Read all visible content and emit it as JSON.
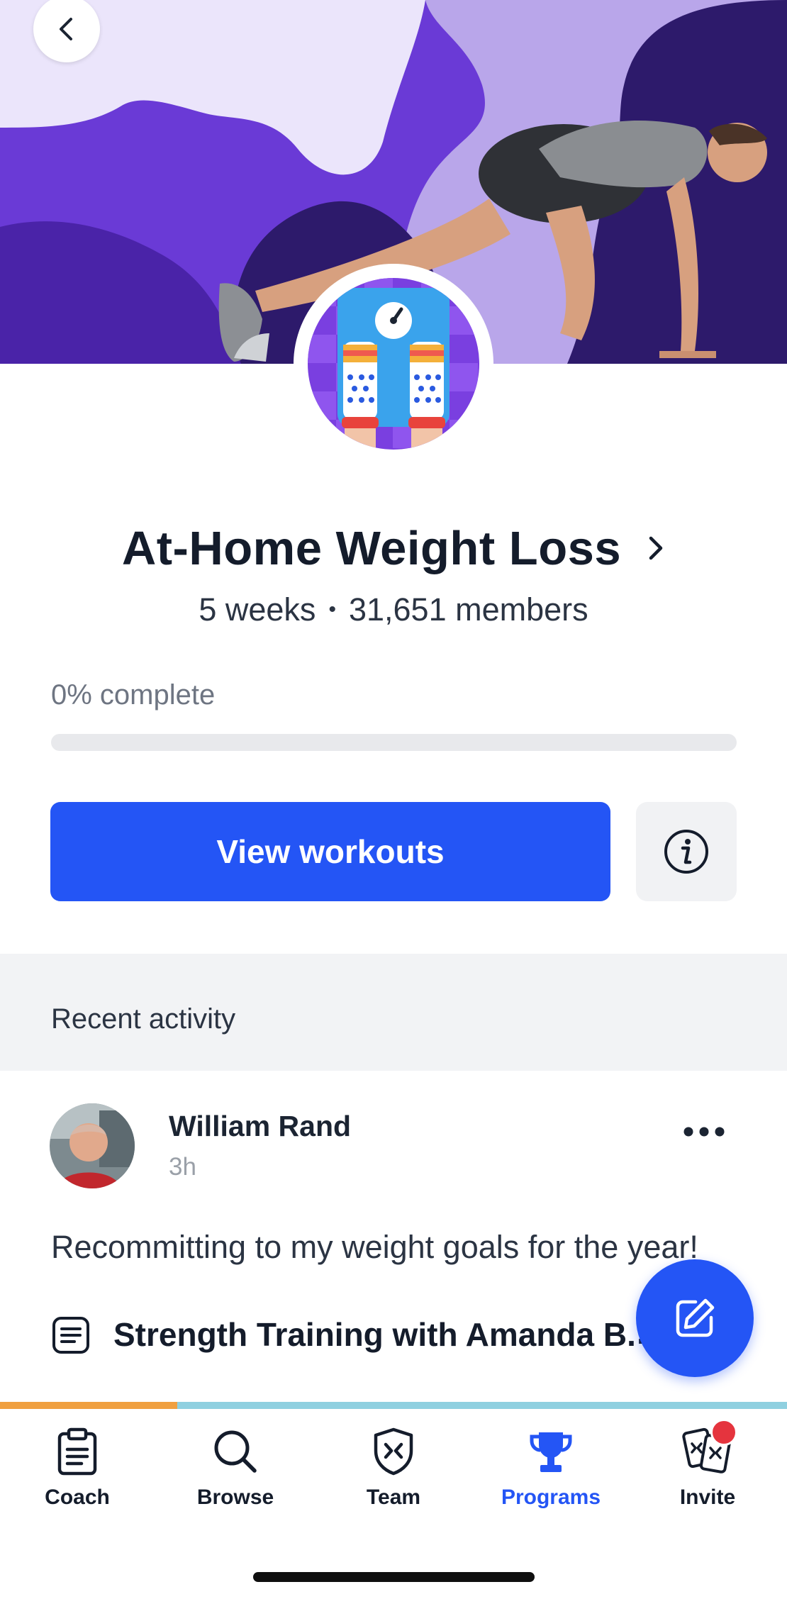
{
  "hero": {
    "colors": {
      "base": "#6a3ad6",
      "light": "#ebe5fb",
      "mid": "#b9a6ea",
      "dark": "#4a23a8",
      "deep": "#2d1a6b"
    }
  },
  "program": {
    "title": "At-Home Weight Loss",
    "duration": "5 weeks",
    "separator": "•",
    "members": "31,651 members"
  },
  "progress": {
    "label": "0% complete",
    "value": 0
  },
  "actions": {
    "view_workouts": "View workouts"
  },
  "recent_activity": {
    "title": "Recent activity",
    "post": {
      "author": "William Rand",
      "time": "3h",
      "body": "Recommitting to my weight goals for the year!",
      "workout": "Strength Training with Amanda B.",
      "workout_trail": "."
    }
  },
  "tabs": [
    {
      "label": "Coach",
      "icon": "clipboard-icon",
      "active": false
    },
    {
      "label": "Browse",
      "icon": "search-icon",
      "active": false
    },
    {
      "label": "Team",
      "icon": "shield-icon",
      "active": false
    },
    {
      "label": "Programs",
      "icon": "trophy-icon",
      "active": true
    },
    {
      "label": "Invite",
      "icon": "invite-cards-icon",
      "active": false
    }
  ],
  "colors": {
    "accent": "#2455f5",
    "notification": "#e5343e"
  }
}
